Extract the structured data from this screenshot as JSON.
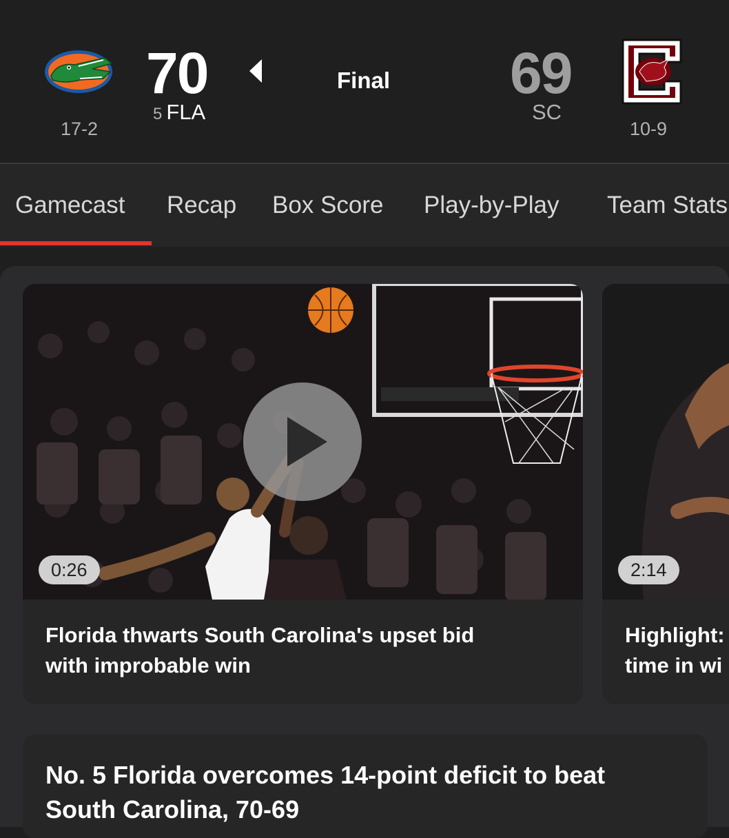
{
  "game": {
    "status": "Final",
    "home": {
      "score": "70",
      "rank": "5",
      "abbr": "FLA",
      "record": "17-2",
      "logo": "florida-gators-logo"
    },
    "away": {
      "score": "69",
      "abbr": "SC",
      "record": "10-9",
      "logo": "south-carolina-gamecocks-logo"
    }
  },
  "tabs": [
    "Gamecast",
    "Recap",
    "Box Score",
    "Play-by-Play",
    "Team Stats"
  ],
  "active_tab": "Gamecast",
  "videos": [
    {
      "duration": "0:26",
      "title_line1": "Florida thwarts South Carolina's upset bid",
      "title_line2": "with improbable win"
    },
    {
      "duration": "2:14",
      "title_line1": "Highlight:",
      "title_line2": "time in wi"
    }
  ],
  "story": {
    "title_line1": "No. 5 Florida overcomes 14-point deficit to beat",
    "title_line2": "South Carolina, 70-69"
  },
  "colors": {
    "accent": "#e1352d",
    "background": "#1f1f20",
    "card": "#262627",
    "muted": "#b3b3b3",
    "fla_orange": "#f26a21",
    "fla_blue": "#1b5aa7",
    "sc_garnet": "#73000a"
  }
}
